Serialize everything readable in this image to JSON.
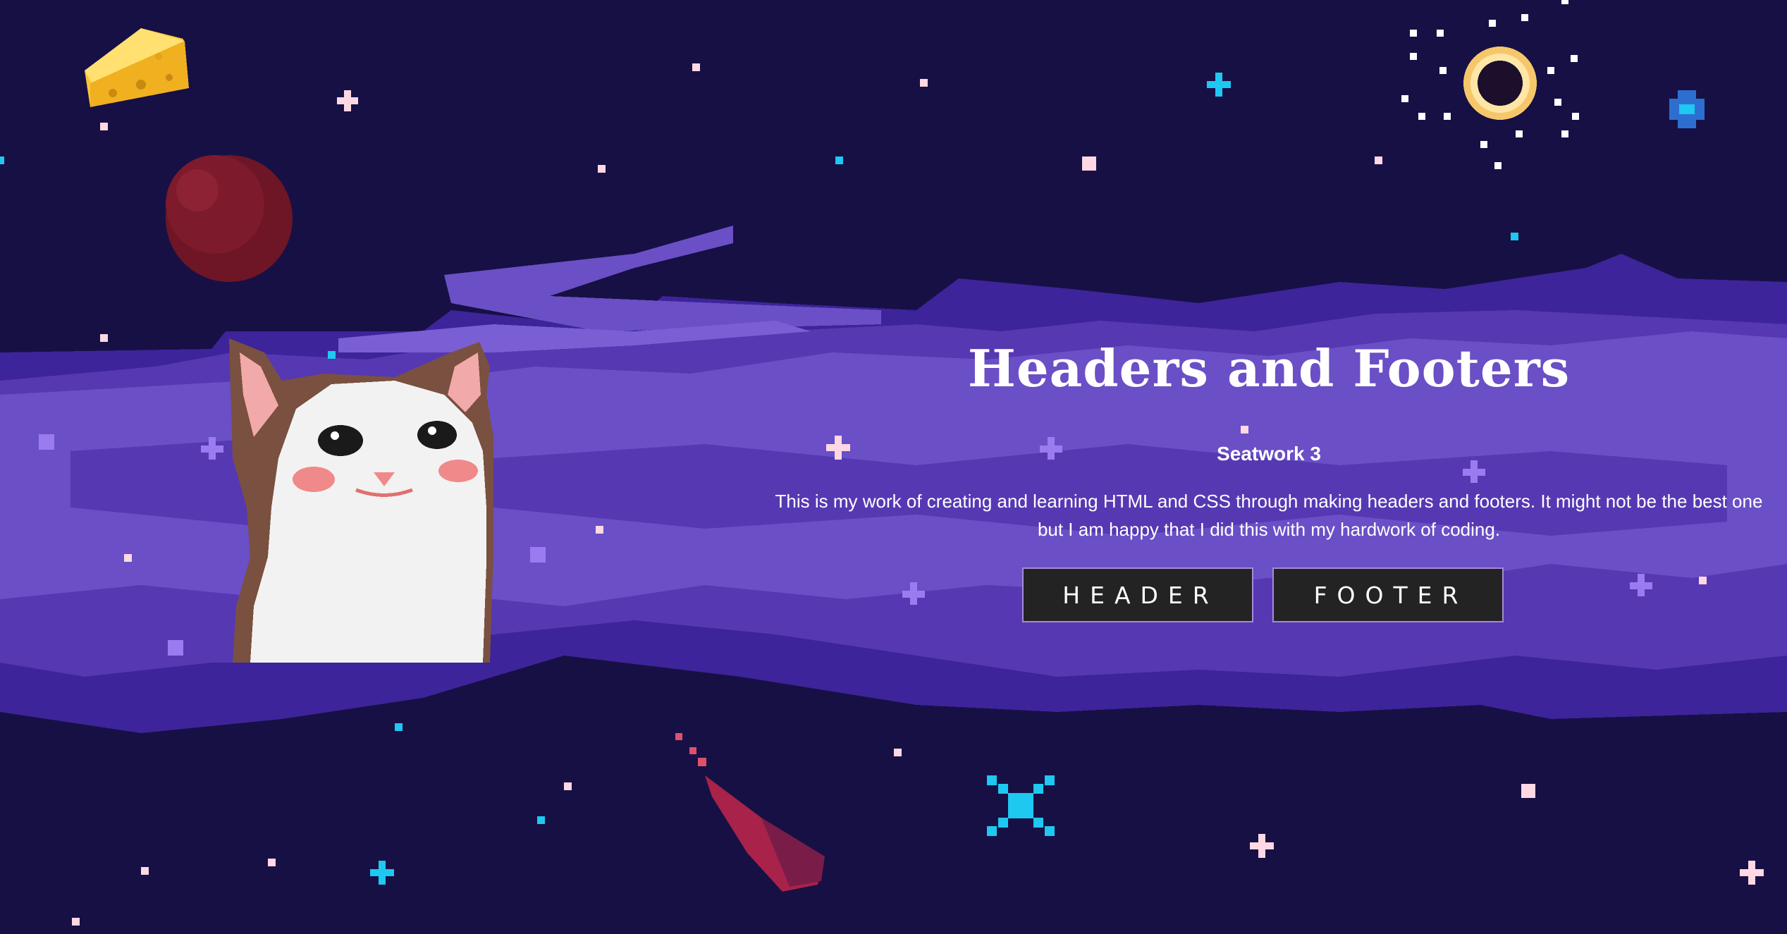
{
  "hero": {
    "title": "Headers and Footers",
    "subtitle": "Seatwork 3",
    "description": "This is my work of creating and learning HTML and CSS through making headers and footers. It might not be the best one but I am happy that I did this with my hardwork of coding.",
    "buttons": {
      "header_label": "HEADER",
      "footer_label": "FOOTER"
    }
  },
  "colors": {
    "background": "#171045",
    "nebula_light": "#6a4fc6",
    "nebula_mid": "#5638b3",
    "nebula_dark": "#3d249a",
    "button_bg": "#232323",
    "button_border": "#a58bd6"
  },
  "decorations": [
    "cheese-icon",
    "red-planet-icon",
    "pixel-cat",
    "ringed-sun-icon",
    "comet-icon",
    "blue-star-icon",
    "sparkle-stars"
  ]
}
